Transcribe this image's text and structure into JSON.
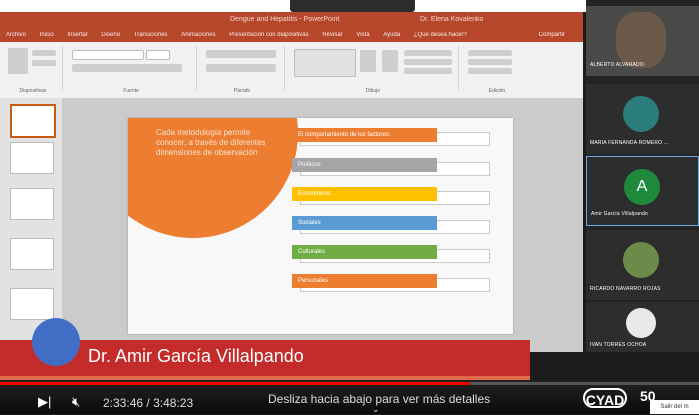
{
  "powerpoint": {
    "window_title": "Dengue and Hepatitis - PowerPoint",
    "user_name": "Dr. Elena Kovalenko",
    "menu": [
      "Archivo",
      "Inicio",
      "Insertar",
      "Diseño",
      "Transiciones",
      "Animaciones",
      "Presentación con diapositivas",
      "Revisar",
      "Vista",
      "Ayuda",
      "¿Qué desea hacer?"
    ],
    "share_label": "Compartir",
    "ribbon_groups": [
      "Diapositivas",
      "Fuente",
      "Párrafo",
      "Dibujo",
      "Edición"
    ]
  },
  "slide": {
    "intro_text": "Cada metodología permite conocer, a través de diferentes dimensiones de observación",
    "header_box": "El comportamiento de los factores:",
    "items": [
      {
        "label": "Políticos",
        "color": "#a5a5a5"
      },
      {
        "label": "Económicos",
        "color": "#ffc000"
      },
      {
        "label": "Sociales",
        "color": "#5b9bd5"
      },
      {
        "label": "Culturales",
        "color": "#70ad47"
      },
      {
        "label": "Personales",
        "color": "#ed7d31"
      }
    ],
    "header_color": "#ed7d31"
  },
  "participants": [
    {
      "name": "ALBERTO ALVARADO",
      "avatar_color": "#6b5a4a"
    },
    {
      "name": "MARIA FERNANDA ROMERO ...",
      "avatar_color": "#2a7d7a"
    },
    {
      "name": "Amir García Villalpando",
      "avatar_letter": "A",
      "avatar_color": "#1f8a3c"
    },
    {
      "name": "RICARDO NAVARRO ROJAS",
      "avatar_color": "#6c8a4a"
    },
    {
      "name": "IVAN TORRES OCHOA",
      "avatar_color": "#e9e9e9"
    }
  ],
  "lower_third": {
    "name": "Dr. Amir García Villalpando"
  },
  "player": {
    "current_time": "2:33:46",
    "duration": "3:48:23",
    "separator": "/",
    "swipe_hint": "Desliza hacia abajo para ver más detalles",
    "progress": 0.672,
    "logo_text": "CYAD",
    "logo2_text": "50",
    "exit_label": "Salir del m"
  }
}
